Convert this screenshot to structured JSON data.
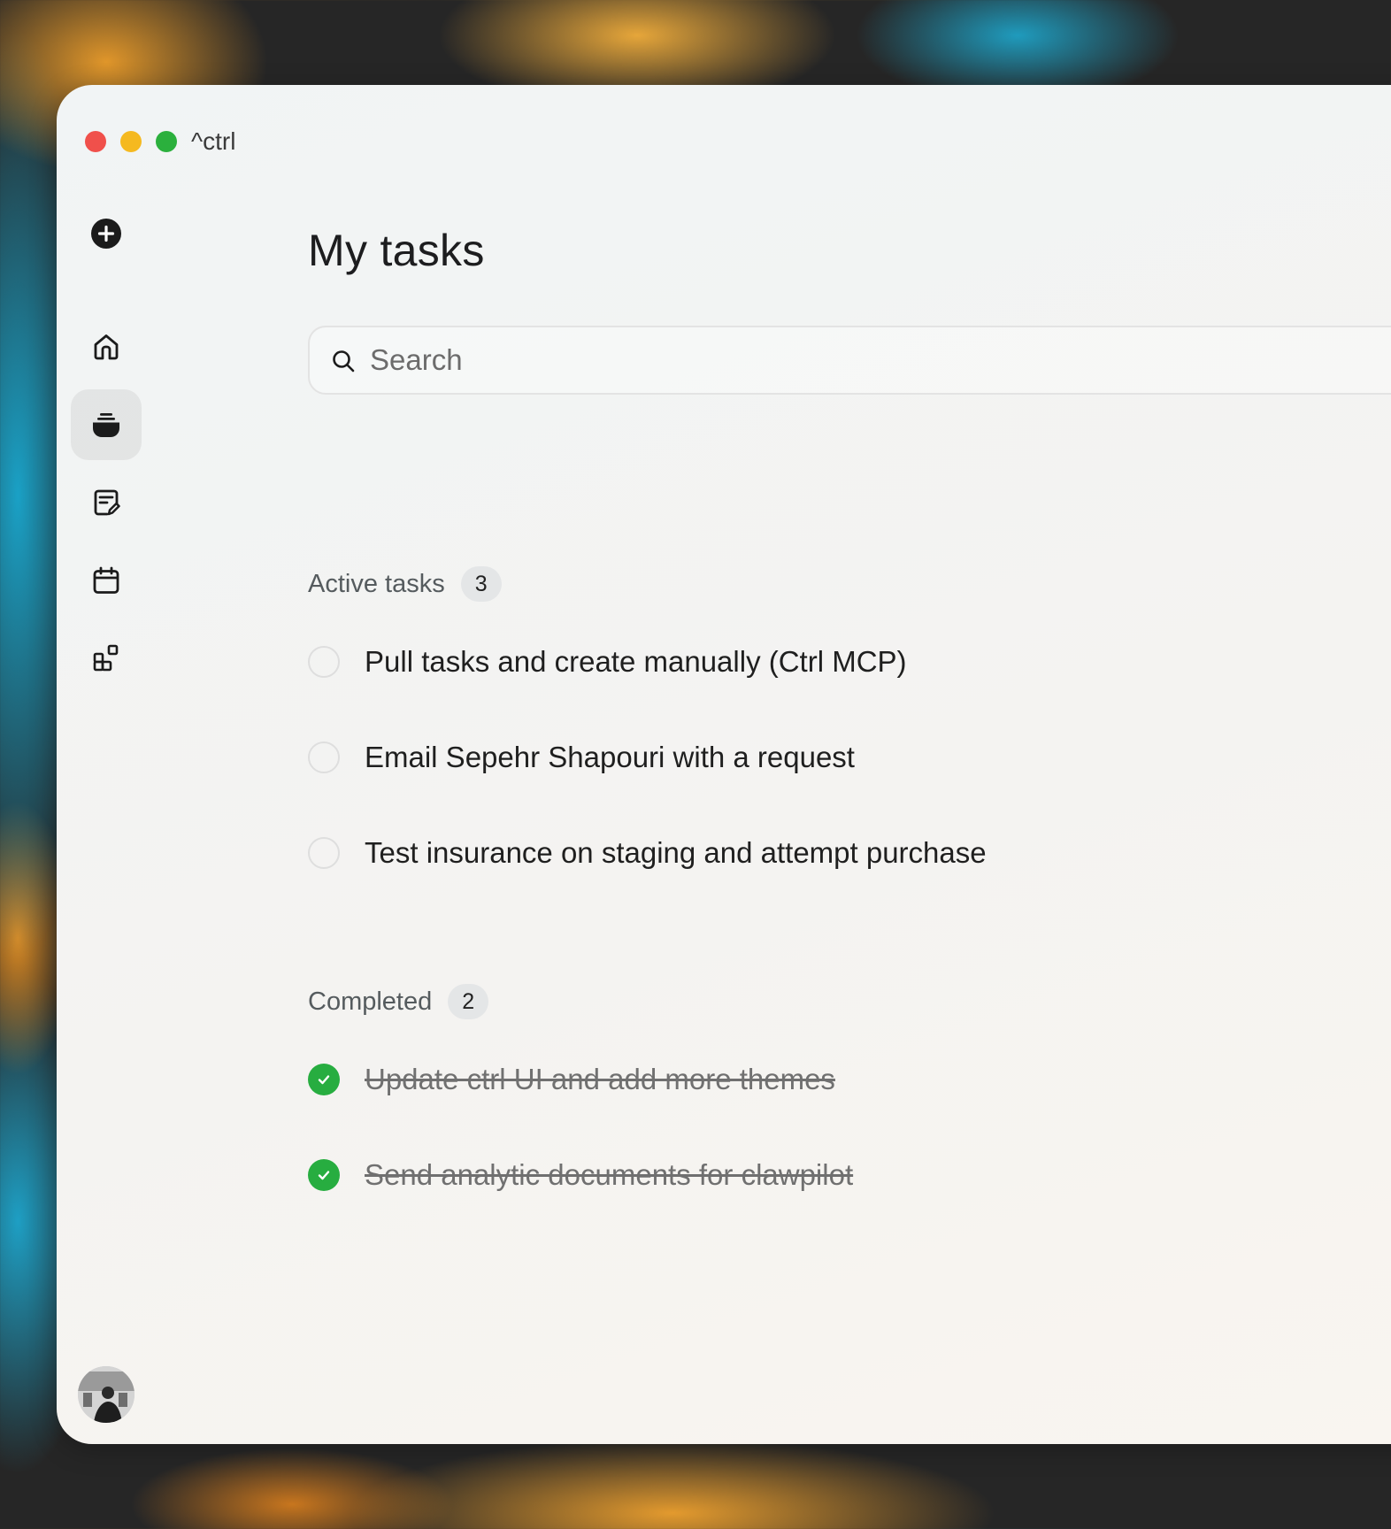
{
  "window": {
    "app_title": "^ctrl"
  },
  "sidebar": {
    "items": [
      {
        "icon": "add-icon"
      },
      {
        "icon": "home-icon"
      },
      {
        "icon": "inbox-stack-icon",
        "active": true
      },
      {
        "icon": "notes-icon"
      },
      {
        "icon": "calendar-icon"
      },
      {
        "icon": "apps-icon"
      }
    ]
  },
  "main": {
    "title": "My tasks",
    "search": {
      "placeholder": "Search",
      "value": ""
    },
    "active": {
      "label": "Active tasks",
      "count": "3",
      "tasks": [
        {
          "text": "Pull tasks and create manually (Ctrl MCP)",
          "done": false
        },
        {
          "text": "Email Sepehr Shapouri with a request",
          "done": false
        },
        {
          "text": "Test insurance on staging and attempt purchase",
          "done": false
        }
      ]
    },
    "completed": {
      "label": "Completed",
      "count": "2",
      "tasks": [
        {
          "text": "Update ctrl UI and add more themes",
          "done": true
        },
        {
          "text": "Send analytic documents for clawpilot",
          "done": true
        }
      ]
    }
  },
  "colors": {
    "accent_green": "#27ad40",
    "close": "#f0504b",
    "minimize": "#f5b920",
    "maximize": "#2bb03d"
  }
}
